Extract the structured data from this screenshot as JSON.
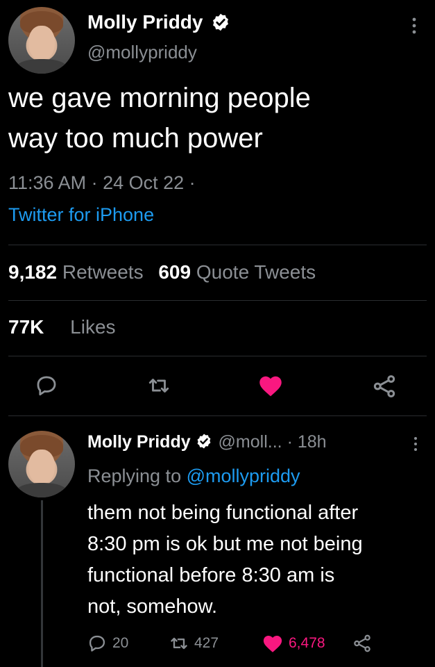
{
  "tweet": {
    "author_name": "Molly Priddy",
    "handle": "@mollypriddy",
    "text_line_1": "we gave morning people",
    "text_line_2": "way too much power",
    "meta": "11:36 AM · 24 Oct 22 ·",
    "source": "Twitter for iPhone",
    "retweets_count": "9,182",
    "retweets_label": "Retweets",
    "quotes_count": "609",
    "quotes_label": "Quote Tweets",
    "likes_count": "77K",
    "likes_label": "Likes"
  },
  "reply": {
    "author_name": "Molly Priddy",
    "handle_truncated": "@moll...",
    "time": "· 18h",
    "replying_prefix": "Replying to",
    "replying_mention": "@mollypriddy",
    "text_lines": [
      "them not being functional after",
      "8:30 pm is ok but me not being",
      "functional before 8:30 am is",
      "not, somehow."
    ],
    "reply_count": "20",
    "retweet_count": "427",
    "like_count": "6,478"
  },
  "colors": {
    "background": "#000000",
    "text": "#ffffff",
    "muted": "#8b8f94",
    "link": "#1d9bf0",
    "like": "#f91880",
    "verified": "#ffffff"
  },
  "icons": [
    "verified-icon",
    "more-icon",
    "reply-icon",
    "retweet-icon",
    "like-icon",
    "share-icon"
  ]
}
